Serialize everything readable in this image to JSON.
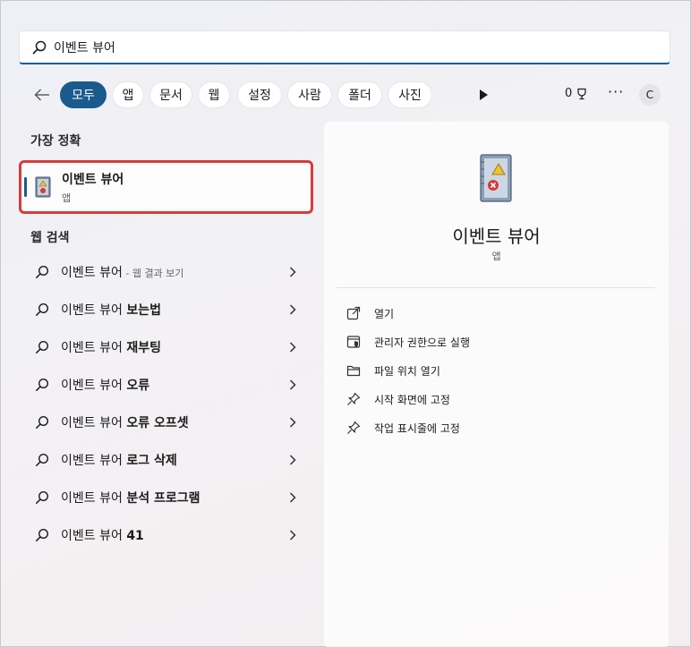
{
  "search": {
    "query": "이벤트 뷰어"
  },
  "filters": {
    "tabs": [
      "모두",
      "앱",
      "문서",
      "웹",
      "설정",
      "사람",
      "폴더",
      "사진"
    ],
    "points": "0",
    "more": "···",
    "avatar": "C"
  },
  "best_match": {
    "heading": "가장 정확",
    "title": "이벤트 뷰어",
    "subtitle": "앱"
  },
  "web_search": {
    "heading": "웹 검색",
    "base": "이벤트 뷰어",
    "first_suffix": " - 웹 결과 보기",
    "items": [
      "",
      "보는법",
      "재부팅",
      "오류",
      "오류 오프셋",
      "로그 삭제",
      "분석 프로그램",
      "41"
    ]
  },
  "detail": {
    "title": "이벤트 뷰어",
    "subtitle": "앱",
    "actions": [
      {
        "label": "열기",
        "icon": "open-icon"
      },
      {
        "label": "관리자 권한으로 실행",
        "icon": "shield-admin-icon"
      },
      {
        "label": "파일 위치 열기",
        "icon": "folder-icon"
      },
      {
        "label": "시작 화면에 고정",
        "icon": "pin-icon"
      },
      {
        "label": "작업 표시줄에 고정",
        "icon": "pin-icon"
      }
    ]
  },
  "colors": {
    "accent": "#1a5a8c",
    "highlight_border": "#d83b3b"
  }
}
